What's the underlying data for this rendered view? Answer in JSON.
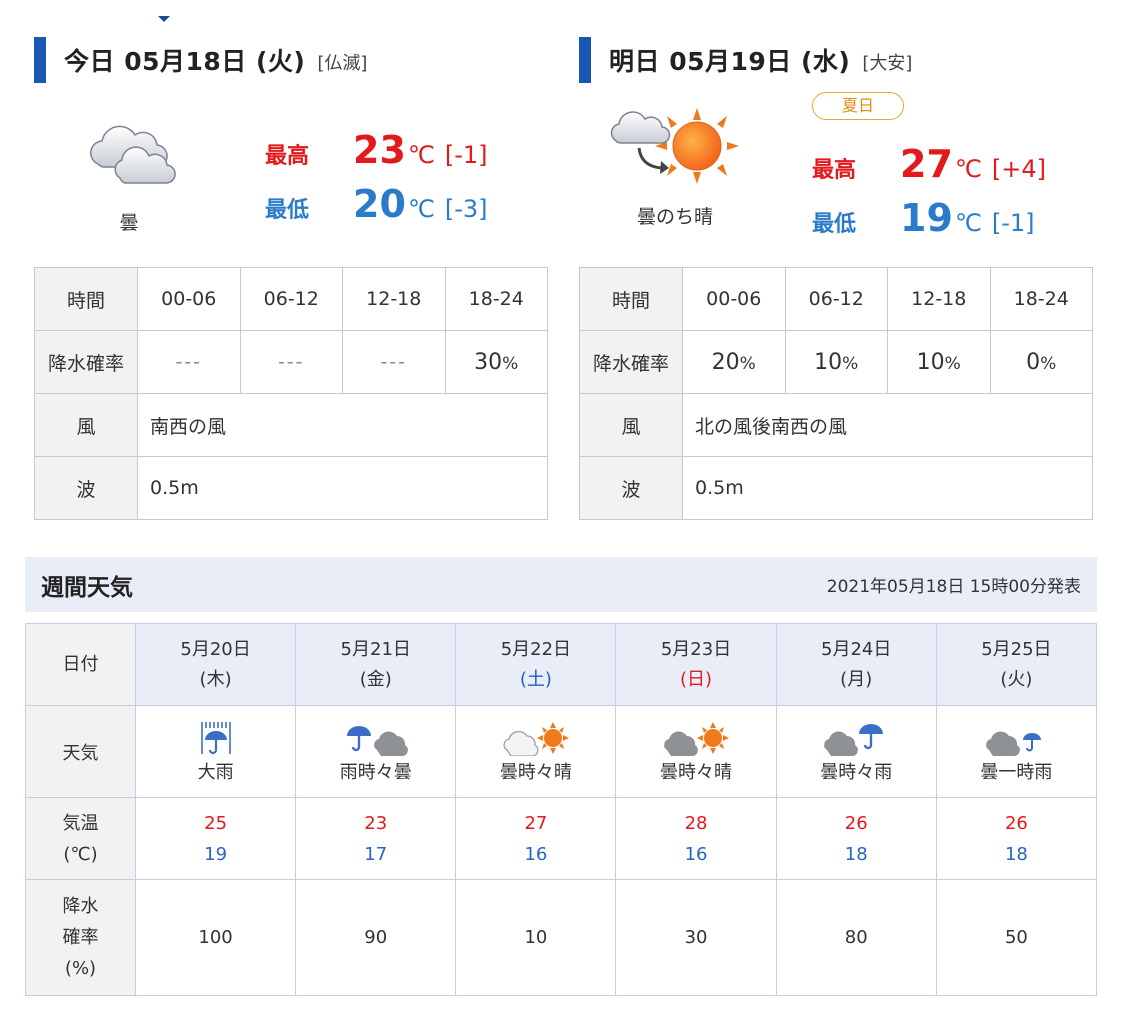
{
  "today": {
    "title": "今日 05月18日 (火)",
    "rokuyo": "[仏滅]",
    "weather": "曇",
    "weather_icon": "cloudy-icon",
    "high_label": "最高",
    "high": "23",
    "high_diff": "[-1]",
    "low_label": "最低",
    "low": "20",
    "low_diff": "[-3]",
    "unit": "℃",
    "table": {
      "time_label": "時間",
      "slots": [
        "00-06",
        "06-12",
        "12-18",
        "18-24"
      ],
      "pop_label": "降水確率",
      "pop": [
        "---",
        "---",
        "---",
        "30"
      ],
      "pct": "%",
      "wind_label": "風",
      "wind": "南西の風",
      "wave_label": "波",
      "wave": "0.5m"
    }
  },
  "tomorrow": {
    "title": "明日 05月19日 (水)",
    "rokuyo": "[大安]",
    "badge": "夏日",
    "weather": "曇のち晴",
    "weather_icon": "cloudy-then-sunny-icon",
    "high_label": "最高",
    "high": "27",
    "high_diff": "[+4]",
    "low_label": "最低",
    "low": "19",
    "low_diff": "[-1]",
    "unit": "℃",
    "table": {
      "time_label": "時間",
      "slots": [
        "00-06",
        "06-12",
        "12-18",
        "18-24"
      ],
      "pop_label": "降水確率",
      "pop": [
        "20",
        "10",
        "10",
        "0"
      ],
      "pct": "%",
      "wind_label": "風",
      "wind": "北の風後南西の風",
      "wave_label": "波",
      "wave": "0.5m"
    }
  },
  "weekly": {
    "title": "週間天気",
    "issued": "2021年05月18日 15時00分発表",
    "row_labels": {
      "date": "日付",
      "weather": "天気",
      "temp_1": "気温",
      "temp_2": "(℃)",
      "pop_1": "降水",
      "pop_2": "確率",
      "pop_3": "(%)"
    },
    "days": [
      {
        "date": "5月20日",
        "dow": "(木)",
        "weather": "大雨",
        "icon": "heavy-rain-icon",
        "high": "25",
        "low": "19",
        "pop": "100"
      },
      {
        "date": "5月21日",
        "dow": "(金)",
        "weather": "雨時々曇",
        "icon": "rain-sometimes-cloudy-icon",
        "high": "23",
        "low": "17",
        "pop": "90"
      },
      {
        "date": "5月22日",
        "dow": "(土)",
        "weather": "曇時々晴",
        "icon": "cloudy-sometimes-sunny-icon",
        "high": "27",
        "low": "16",
        "pop": "10"
      },
      {
        "date": "5月23日",
        "dow": "(日)",
        "weather": "曇時々晴",
        "icon": "cloudy-sometimes-sunny-icon",
        "high": "28",
        "low": "16",
        "pop": "30"
      },
      {
        "date": "5月24日",
        "dow": "(月)",
        "weather": "曇時々雨",
        "icon": "cloudy-sometimes-rain-icon",
        "high": "26",
        "low": "18",
        "pop": "80"
      },
      {
        "date": "5月25日",
        "dow": "(火)",
        "weather": "曇一時雨",
        "icon": "cloudy-briefly-rain-icon",
        "high": "26",
        "low": "18",
        "pop": "50"
      }
    ]
  },
  "colors": {
    "accent_bar": "#1a56b4",
    "high": "#e3191c",
    "low": "#2a7ccb",
    "header_bg": "#e8edf7",
    "badge": "#f0a23a"
  }
}
